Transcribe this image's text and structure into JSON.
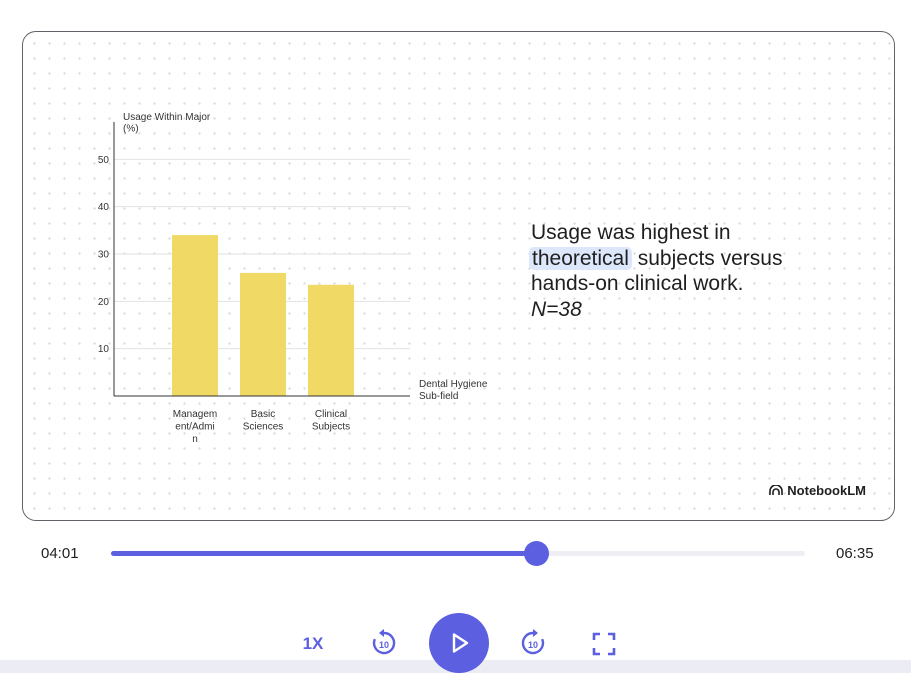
{
  "chart_data": {
    "type": "bar",
    "categories": [
      "Management/Admin",
      "Basic Sciences",
      "Clinical Subjects"
    ],
    "category_label_lines": [
      [
        "Managem",
        "ent/Admi",
        "n"
      ],
      [
        "Basic",
        "Sciences"
      ],
      [
        "Clinical",
        "Subjects"
      ]
    ],
    "values": [
      34,
      26,
      23.5
    ],
    "ylabel_lines": [
      "Usage Within Major",
      "(%)"
    ],
    "xlabel_lines": [
      "Dental Hygiene",
      "Sub-field"
    ],
    "yticks": [
      10,
      20,
      30,
      40,
      50
    ],
    "ylim": [
      0,
      60
    ],
    "grid": true,
    "bar_color": "#f0d964",
    "grid_color": "#e2e2e2"
  },
  "slide": {
    "statement_before": "Usage was highest in",
    "statement_highlight": "theoretical",
    "statement_after": "subjects versus hands-on clinical work.",
    "n_value": "N=38",
    "brand_name": "NotebookLM"
  },
  "player": {
    "current_time": "04:01",
    "total_time": "06:35",
    "progress_fraction": 0.612,
    "speed_label": "1X",
    "rewind_amount": "10",
    "forward_amount": "10",
    "accent_color": "#5b5fe0"
  },
  "icons": {
    "rewind": "rewind-10-icon",
    "play": "play-icon",
    "forward": "forward-10-icon",
    "fullscreen": "fullscreen-icon",
    "brand": "notebooklm-logo-icon"
  }
}
